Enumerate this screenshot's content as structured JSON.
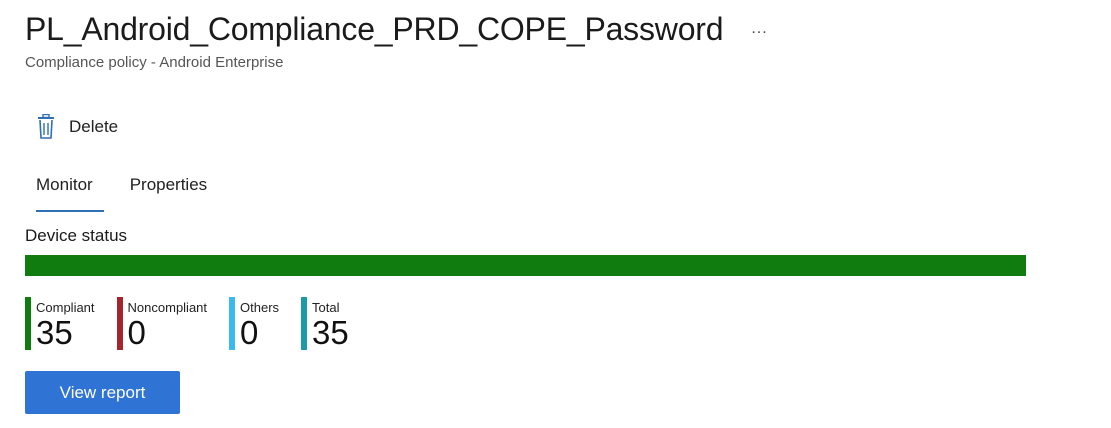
{
  "header": {
    "title": "PL_Android_Compliance_PRD_COPE_Password",
    "more_label": "...",
    "subtitle": "Compliance policy - Android Enterprise"
  },
  "toolbar": {
    "delete_label": "Delete",
    "delete_icon": "trash-icon"
  },
  "tabs": [
    {
      "label": "Monitor",
      "active": true
    },
    {
      "label": "Properties",
      "active": false
    }
  ],
  "device_status": {
    "title": "Device status",
    "bar_fill_fraction": 1.0,
    "bar_color": "#107c10",
    "stats": [
      {
        "label": "Compliant",
        "value": "35",
        "color": "#107c10"
      },
      {
        "label": "Noncompliant",
        "value": "0",
        "color": "#a4262c"
      },
      {
        "label": "Others",
        "value": "0",
        "color": "#3cb8f0"
      },
      {
        "label": "Total",
        "value": "35",
        "color": "#1b9aaa"
      }
    ]
  },
  "actions": {
    "view_report_label": "View report"
  },
  "colors": {
    "accent": "#2f73d5",
    "tab_underline": "#2f6fb6"
  }
}
